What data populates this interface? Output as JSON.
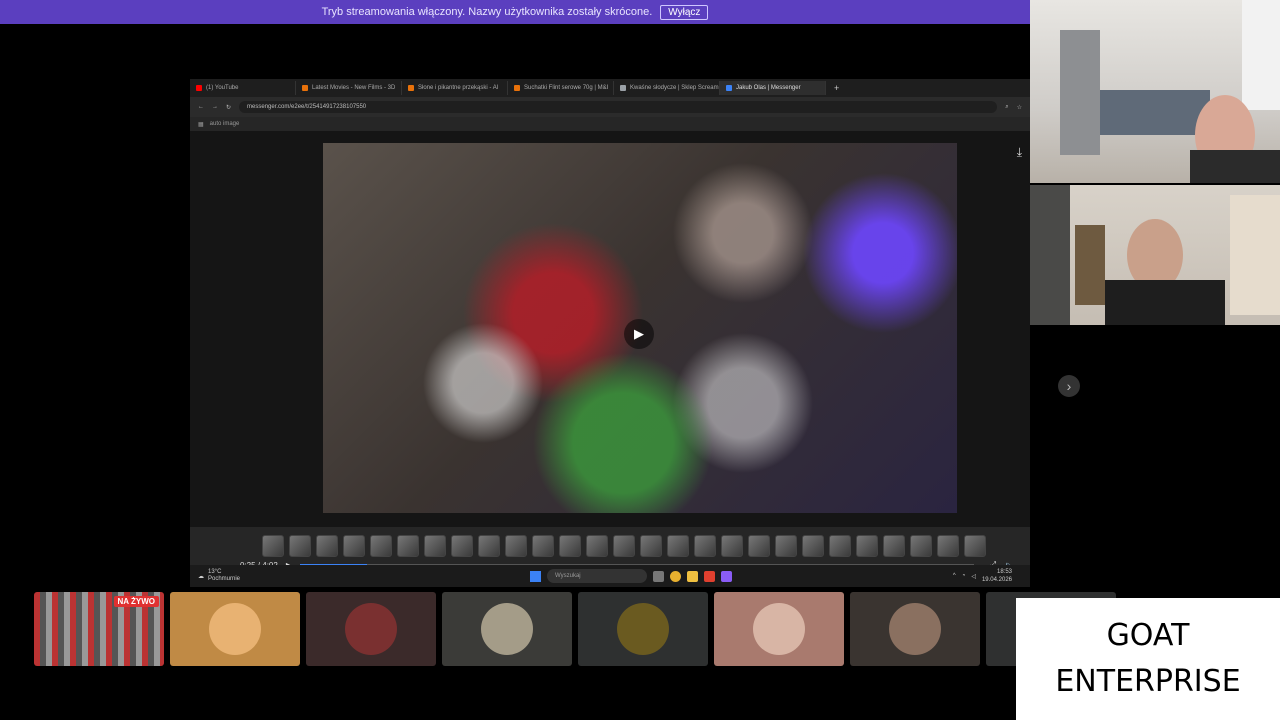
{
  "banner": {
    "text": "Tryb streamowania włączony. Nazwy użytkownika zostały skrócone.",
    "button": "Wyłącz"
  },
  "colors": {
    "banner": "#5b3fbf",
    "live": "#e03131",
    "progress": "#3b82f6"
  },
  "browser": {
    "tabs": [
      {
        "label": "(1) YouTube",
        "color": "#ff0000"
      },
      {
        "label": "Latest Movies - New Films - 3D",
        "color": "#e8710a"
      },
      {
        "label": "Słone i pikantne przekąski - Al",
        "color": "#e8710a"
      },
      {
        "label": "Suchatki Flint serowe 70g | M&I",
        "color": "#e8710a"
      },
      {
        "label": "Kwaśne słodycze | Sklep Scream",
        "color": "#9aa0a6"
      },
      {
        "label": "Jakub Olas | Messenger",
        "color": "#3b82f6"
      }
    ],
    "url": "messenger.com/e2ee/t/25414917238107550",
    "bookmark": "auto image"
  },
  "video": {
    "time": "0:25 / 4:02",
    "progress": 0.1
  },
  "taskbar": {
    "temperature": "13°C",
    "weather": "Pochmurnie",
    "search_placeholder": "Wyszukaj",
    "time": "18:53",
    "date": "19.04.2026"
  },
  "participants": {
    "live_badge": "NA ŻYWO",
    "tiles": [
      {
        "bg": "#3a3a3a",
        "avatar": ""
      },
      {
        "bg": "#c08a45",
        "avatar": "#e8b272"
      },
      {
        "bg": "#3b2a2a",
        "avatar": "#7a3030"
      },
      {
        "bg": "#3b3b38",
        "avatar": "#a49c88"
      },
      {
        "bg": "#2e3030",
        "avatar": "#6a5a20"
      },
      {
        "bg": "#a97a6e",
        "avatar": "#d8b5a5"
      },
      {
        "bg": "#3a3430",
        "avatar": "#8a7060"
      },
      {
        "bg": "#2f3030",
        "avatar": ""
      }
    ]
  },
  "overlay": {
    "line1": "GOAT",
    "line2": "ENTERPRISE"
  }
}
